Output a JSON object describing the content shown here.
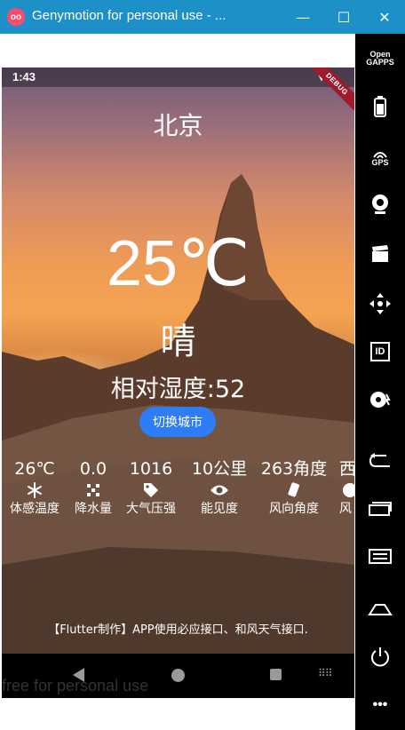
{
  "window": {
    "title": "Genymotion for personal use - ...",
    "logo_text": "oo",
    "controls": {
      "minimize": "—",
      "maximize": "☐",
      "close": "✕"
    }
  },
  "status_bar": {
    "time": "1:43",
    "icons": [
      "wifi-icon",
      "battery-icon"
    ],
    "debug_ribbon": "DEBUG"
  },
  "weather": {
    "city": "北京",
    "temperature": "25℃",
    "condition": "晴",
    "humidity": "相对湿度:52",
    "switch_button": "切换城市"
  },
  "metrics": [
    {
      "value": "26℃",
      "icon": "snowflake-icon",
      "label": "体感温度"
    },
    {
      "value": "0.0",
      "icon": "rain-dots-icon",
      "label": "降水量"
    },
    {
      "value": "1016",
      "icon": "pressure-tag-icon",
      "label": "大气压强"
    },
    {
      "value": "10公里",
      "icon": "eye-icon",
      "label": "能见度"
    },
    {
      "value": "263角度",
      "icon": "wind-direction-icon",
      "label": "风向角度"
    },
    {
      "value": "西",
      "icon": "wind-icon",
      "label": "风"
    }
  ],
  "footer_note": "【Flutter制作】APP使用必应接口、和风天气接口.",
  "watermark": "free for personal use",
  "nav_bar": {
    "keyboard_glyph": "⠿⠿"
  },
  "sidebar": {
    "items": [
      {
        "icon": "open-gapps-icon",
        "label": "Open\nGAPPS"
      },
      {
        "icon": "battery-icon",
        "label": ""
      },
      {
        "icon": "gps-icon",
        "label": "GPS"
      },
      {
        "icon": "webcam-icon",
        "label": ""
      },
      {
        "icon": "media-clapper-icon",
        "label": ""
      },
      {
        "icon": "dpad-icon",
        "label": ""
      },
      {
        "icon": "device-id-icon",
        "label": "ID"
      },
      {
        "icon": "disk-icon",
        "label": ""
      },
      {
        "icon": "back-icon",
        "label": ""
      },
      {
        "icon": "recent-apps-icon",
        "label": ""
      },
      {
        "icon": "menu-icon",
        "label": ""
      },
      {
        "icon": "home-icon",
        "label": ""
      },
      {
        "icon": "power-icon",
        "label": ""
      },
      {
        "icon": "more-icon",
        "label": "•••"
      }
    ]
  },
  "colors": {
    "titlebar": "#1e90c8",
    "button": "#2f7df6",
    "sidebar": "#000000",
    "debug": "#a11a2b"
  }
}
